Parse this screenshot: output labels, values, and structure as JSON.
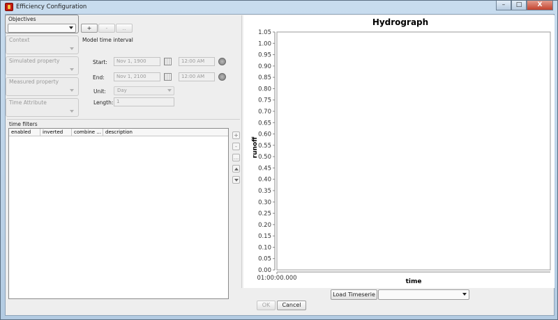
{
  "window": {
    "title": "Efficiency Configuration",
    "controls": {
      "minimize": "–",
      "maximize": "□",
      "close": "X"
    }
  },
  "objectives": {
    "label": "Objectives",
    "add_label": "+",
    "remove_label": "-",
    "more_label": ".."
  },
  "context": {
    "label": "Context"
  },
  "simulated_property": {
    "label": "Simulated property"
  },
  "measured_property": {
    "label": "Measured property"
  },
  "time_attribute": {
    "label": "Time Attribute"
  },
  "model_time_interval": {
    "label": "Model time interval",
    "start_label": "Start:",
    "start_date": "Nov 1, 1900",
    "start_time": "12:00 AM",
    "end_label": "End:",
    "end_date": "Nov 1, 2100",
    "end_time": "12:00 AM",
    "unit_label": "Unit:",
    "unit_value": "Day",
    "length_label": "Length:",
    "length_value": "1"
  },
  "time_filters": {
    "label": "time filters",
    "columns": [
      "enabled",
      "inverted",
      "combine ...",
      "description"
    ],
    "add_label": "+",
    "remove_label": "-",
    "more_label": "..."
  },
  "chart_data": {
    "type": "line",
    "title": "Hydrograph",
    "xlabel": "time",
    "ylabel": "runoff",
    "ylim": [
      0.0,
      1.05
    ],
    "ytick_step": 0.05,
    "ytick_labels": [
      "0.00",
      "0.05",
      "0.10",
      "0.15",
      "0.20",
      "0.25",
      "0.30",
      "0.35",
      "0.40",
      "0.45",
      "0.50",
      "0.55",
      "0.60",
      "0.65",
      "0.70",
      "0.75",
      "0.80",
      "0.85",
      "0.90",
      "0.95",
      "1.00",
      "1.05"
    ],
    "xtick_labels": [
      "01:00:00.000"
    ],
    "series": [],
    "grid": false
  },
  "bottom": {
    "load_timeserie_label": "Load Timeserie",
    "ok_label": "OK",
    "cancel_label": "Cancel"
  }
}
